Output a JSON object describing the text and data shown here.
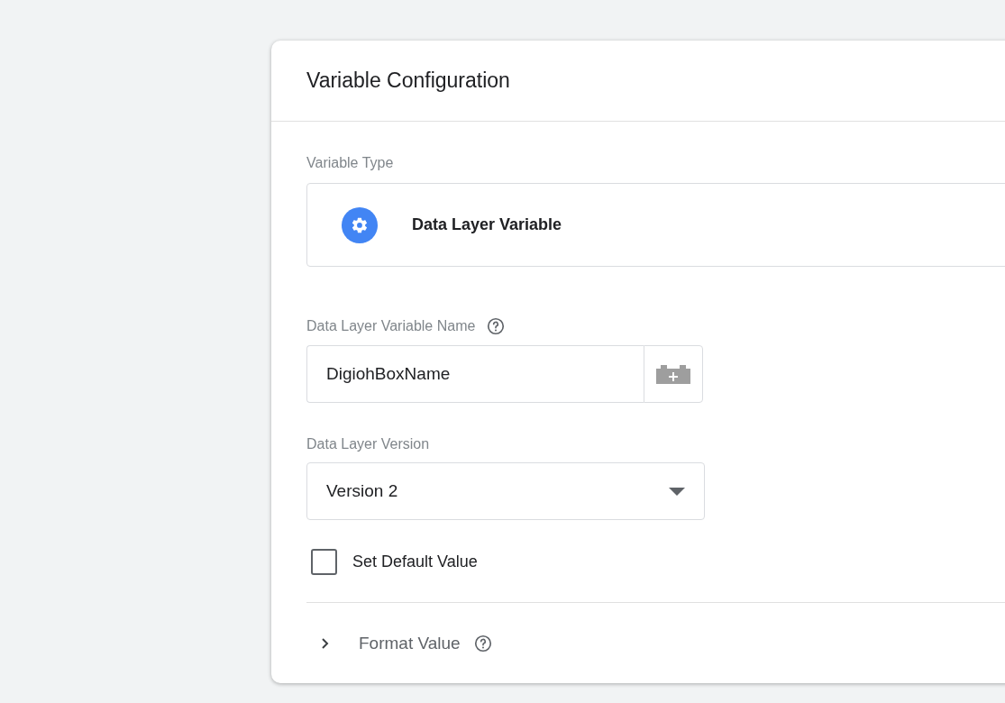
{
  "panel": {
    "title": "Variable Configuration"
  },
  "variable_type": {
    "label": "Variable Type",
    "value": "Data Layer Variable"
  },
  "name_field": {
    "label": "Data Layer Variable Name",
    "value": "DigiohBoxName"
  },
  "version_field": {
    "label": "Data Layer Version",
    "value": "Version 2"
  },
  "default_checkbox": {
    "label": "Set Default Value",
    "checked": false
  },
  "format_value": {
    "label": "Format Value",
    "expanded": false
  }
}
